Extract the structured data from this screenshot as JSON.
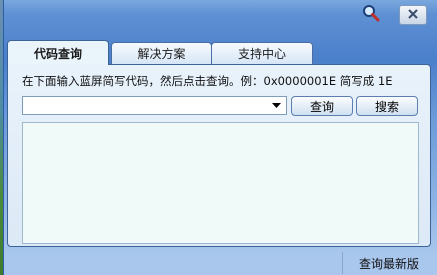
{
  "tabs": [
    {
      "label": "代码查询",
      "active": true
    },
    {
      "label": "解决方案",
      "active": false
    },
    {
      "label": "支持中心",
      "active": false
    }
  ],
  "query_panel": {
    "hint": "在下面输入蓝屏简写代码，然后点击查询。例：0x0000001E 简写成 1E",
    "code_combo_value": "",
    "query_button": "查询",
    "search_button": "搜索",
    "result_text": ""
  },
  "status_bar": {
    "latest_version_link": "查询最新版"
  },
  "colors": {
    "window_blue": "#4a7fca",
    "panel_bg": "#e8f2fb",
    "result_bg": "#effaf9"
  },
  "icons": {
    "search": "search-icon",
    "close": "close-icon",
    "dropdown": "chevron-down-icon"
  }
}
